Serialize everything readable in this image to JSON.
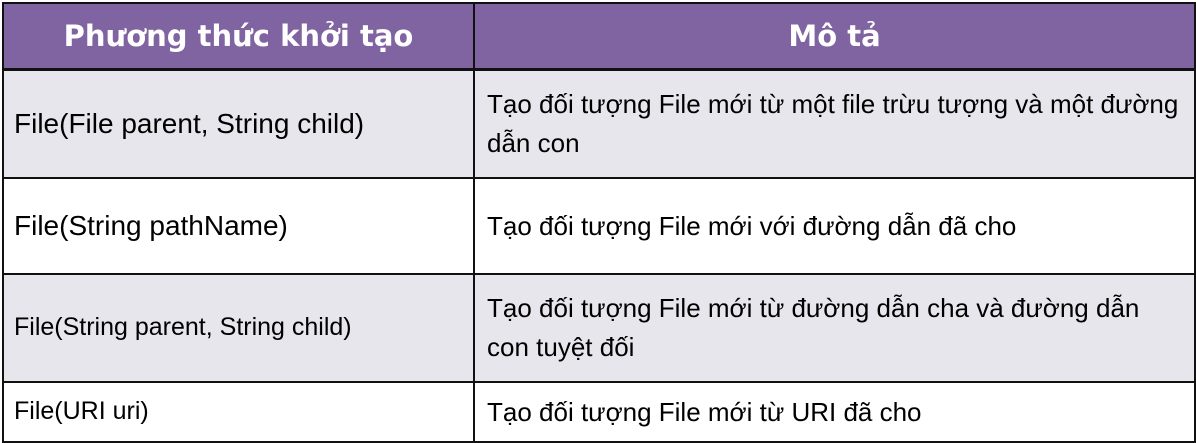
{
  "table": {
    "headers": [
      "Phương thức khởi tạo",
      "Mô tả"
    ],
    "rows": [
      {
        "method": "File(File parent, String child)",
        "description": "Tạo đối tượng File mới từ một file trừu tượng và một đường dẫn con"
      },
      {
        "method": "File(String pathName)",
        "description": "Tạo đối tượng File mới với đường dẫn đã cho"
      },
      {
        "method": "File(String parent, String child)",
        "description": "Tạo đối tượng File mới từ đường dẫn cha và đường dẫn con tuyệt đối"
      },
      {
        "method": "File(URI uri)",
        "description": "Tạo đối tượng File mới từ URI đã cho"
      }
    ]
  },
  "colors": {
    "header_bg": "#8063a1",
    "header_text": "#ffffff",
    "row_shade": "#e8e6ed",
    "border": "#111111"
  }
}
